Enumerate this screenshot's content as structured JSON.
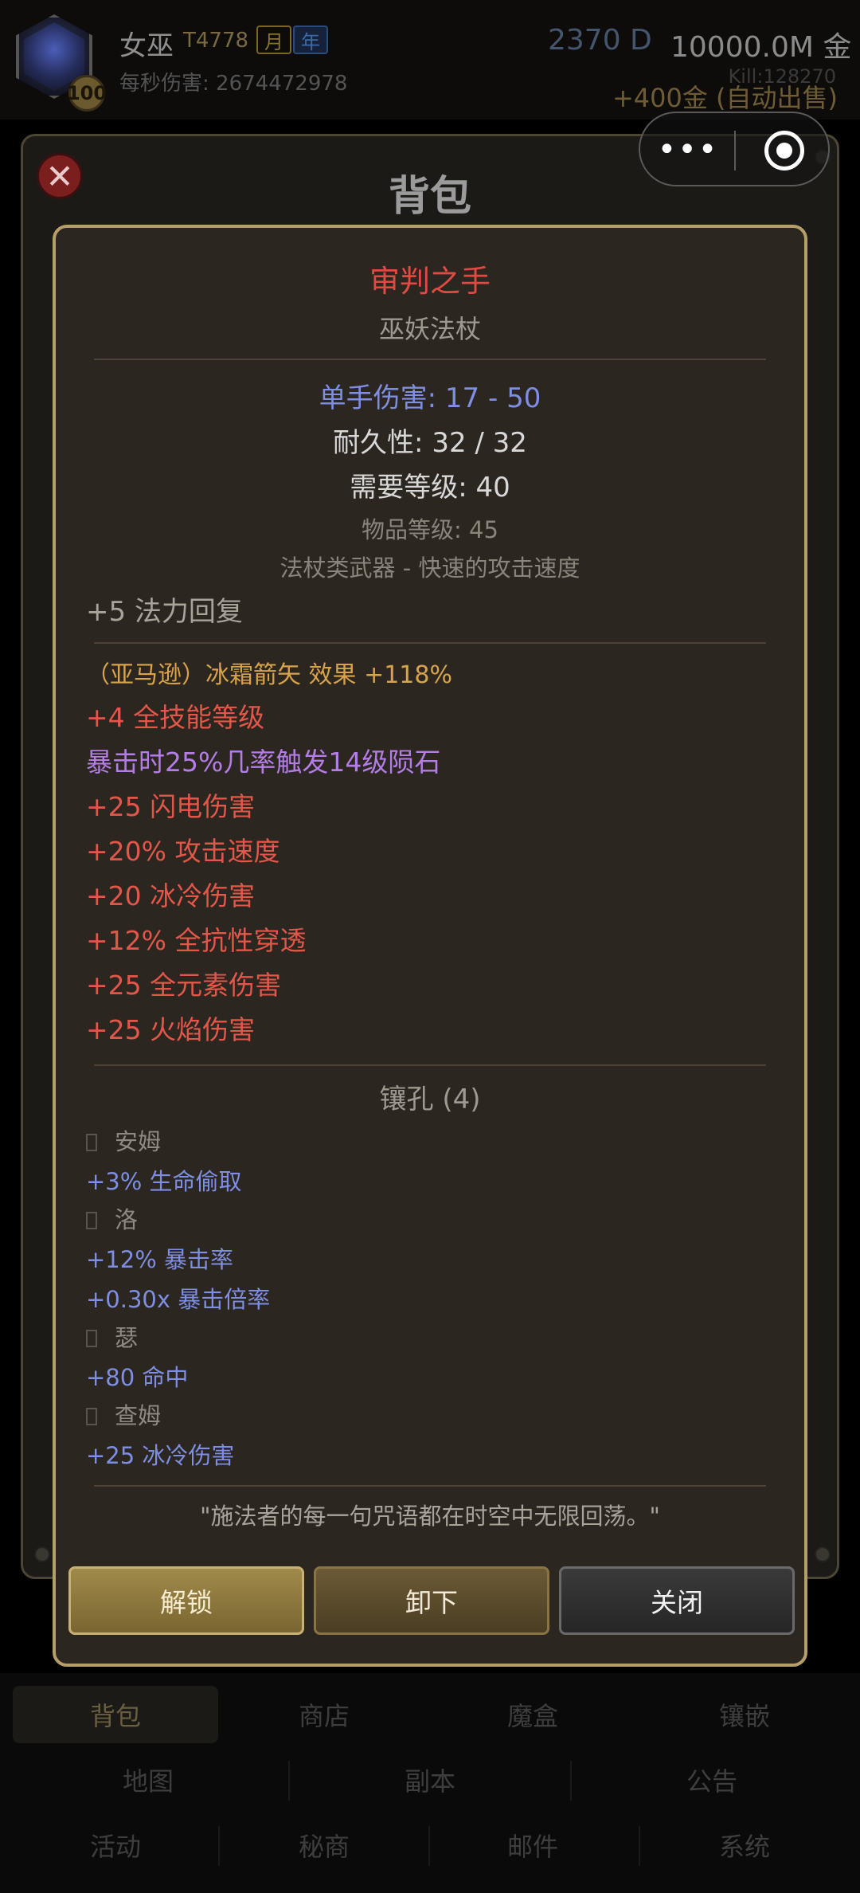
{
  "hud": {
    "level": "100",
    "hero_name": "女巫",
    "hero_id": "T4778",
    "tag_month": "月",
    "tag_year": "年",
    "dps_label": "每秒伤害: 2674472978",
    "diamonds": "2370 D",
    "gold": "10000.0M 金",
    "auto_sell": "+400金 (自动出售)",
    "kills": "Kill:128270"
  },
  "capsule": {
    "more": "•••"
  },
  "bag": {
    "title": "背包",
    "close": "✕"
  },
  "item": {
    "name": "审判之手",
    "type": "巫妖法杖",
    "damage": "单手伤害: 17 - 50",
    "durability": "耐久性: 32 / 32",
    "required_level": "需要等级: 40",
    "item_level": "物品等级: 45",
    "class_line": "法杖类武器 - 快速的攻击速度",
    "implicit": "+5 法力回复",
    "affixes": [
      "（亚马逊）冰霜箭矢 效果 +118%",
      "+4 全技能等级",
      "暴击时25%几率触发14级陨石",
      "+25 闪电伤害",
      "+20% 攻击速度",
      "+20 冰冷伤害",
      "+12% 全抗性穿透",
      "+25 全元素伤害",
      "+25 火焰伤害"
    ],
    "socket_title": "镶孔 (4)",
    "runes": [
      {
        "name": "安姆",
        "stats": [
          "+3% 生命偷取"
        ]
      },
      {
        "name": "洛",
        "stats": [
          "+12% 暴击率",
          "+0.30x 暴击倍率"
        ]
      },
      {
        "name": "瑟",
        "stats": [
          "+80 命中"
        ]
      },
      {
        "name": "查姆",
        "stats": [
          "+25 冰冷伤害"
        ]
      }
    ],
    "flavor": "\"施法者的每一句咒语都在时空中无限回荡。\"",
    "buttons": {
      "unlock": "解锁",
      "unequip": "卸下",
      "close": "关闭"
    }
  },
  "nav": {
    "row1": [
      "背包",
      "商店",
      "魔盒",
      "镶嵌"
    ],
    "row2": [
      "地图",
      "副本",
      "公告"
    ],
    "row3": [
      "活动",
      "秘商",
      "邮件",
      "系统"
    ]
  },
  "colors": {
    "item_name": "#e04a42",
    "magic_blue": "#7e8ee2",
    "affix_red": "#e3574a",
    "affix_purple": "#b47de6",
    "affix_gold": "#d8a34a",
    "card_border": "#b59e69"
  }
}
